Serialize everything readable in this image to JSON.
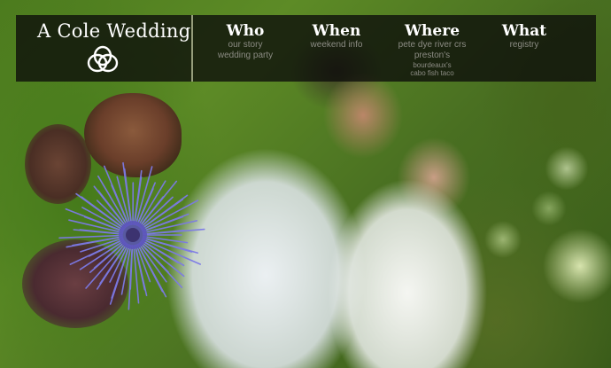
{
  "site": {
    "title": "A Cole Wedding",
    "logo_icon": "interlocked-rings-icon"
  },
  "nav": {
    "who": {
      "heading": "Who",
      "links": [
        "our story",
        "wedding party"
      ]
    },
    "when": {
      "heading": "When",
      "links": [
        "weekend info"
      ]
    },
    "where": {
      "heading": "Where",
      "links": [
        "pete dye river crs",
        "preston's",
        "bourdeaux's",
        "cabo fish taco"
      ]
    },
    "what": {
      "heading": "What",
      "links": [
        "registry"
      ]
    }
  },
  "colors": {
    "nav_background": "rgba(12,12,10,0.78)",
    "heading_text": "#ffffff",
    "sublink_text": "#8c8c84",
    "divider": "#bfc7a0"
  }
}
